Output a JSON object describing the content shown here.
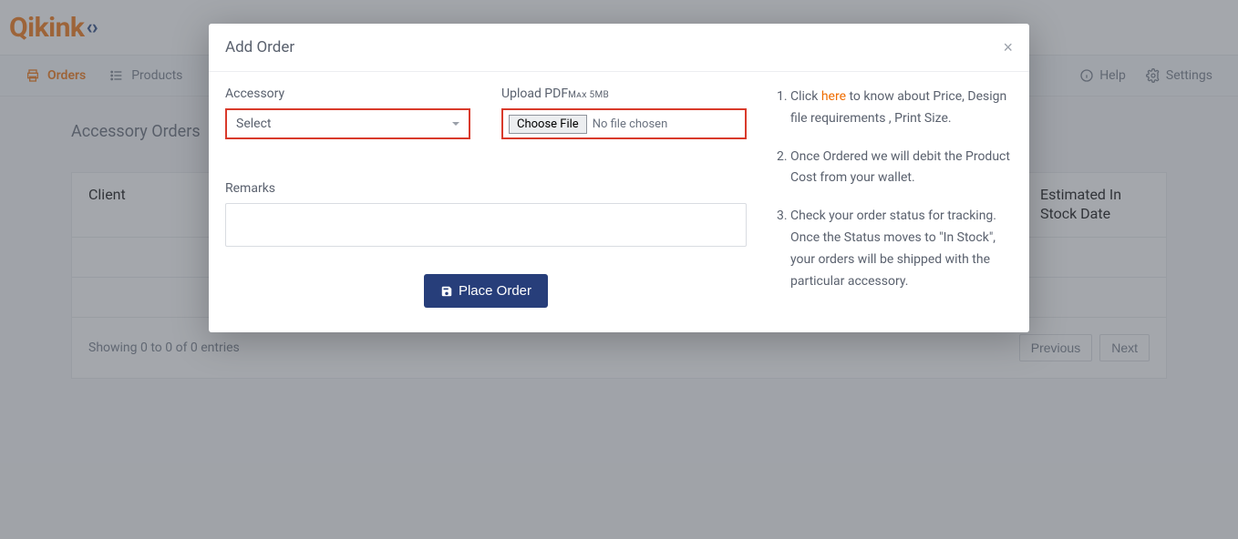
{
  "brand": {
    "text": "Qikink"
  },
  "nav": {
    "orders": "Orders",
    "products": "Products",
    "help": "Help",
    "settings": "Settings"
  },
  "page": {
    "title": "Accessory Orders",
    "col_client": "Client",
    "col_eta": "Estimated In Stock Date",
    "showing": "Showing 0 to 0 of 0 entries",
    "prev": "Previous",
    "next": "Next"
  },
  "modal": {
    "title": "Add Order",
    "accessory_label": "Accessory",
    "accessory_value": "Select",
    "upload_label": "Upload PDF",
    "upload_hint": "Max 5MB",
    "choose_file": "Choose File",
    "no_file": "No file chosen",
    "remarks_label": "Remarks",
    "submit": "Place Order",
    "info_1_a": "Click ",
    "info_1_link": "here",
    "info_1_b": " to know about Price, Design file requirements , Print Size.",
    "info_2": "Once Ordered we will debit the Product Cost from your wallet.",
    "info_3": "Check your order status for tracking. Once the Status moves to \"In Stock\", your orders will be shipped with the particular accessory."
  }
}
